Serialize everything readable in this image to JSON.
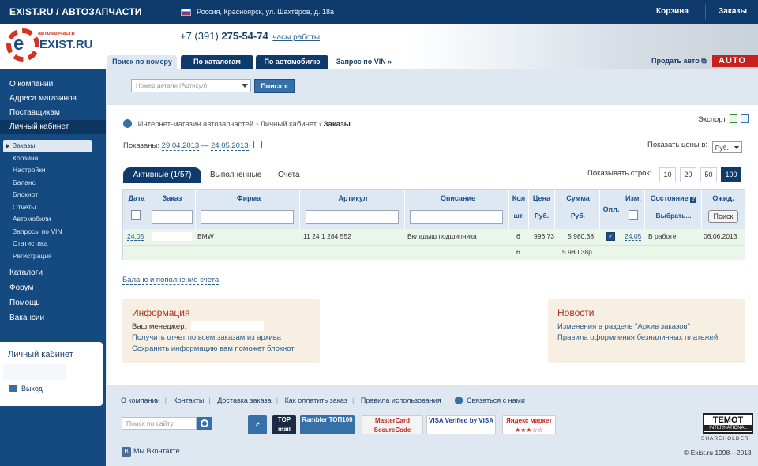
{
  "topbar": {
    "brand": "EXIST.RU / АВТОЗАПЧАСТИ",
    "location": "Россия, Красноярск, ул. Шахтёров, д. 18а",
    "cart": "Корзина",
    "orders": "Заказы"
  },
  "header": {
    "logo_sub": "автозапчасти",
    "logo_name": "EXIST.RU",
    "phone_prefix": "+7 (391)",
    "phone_number": "275-54-74",
    "hours": "часы работы",
    "tabs": [
      "Поиск по номеру",
      "По каталогам",
      "По автомобилю",
      "Запрос по VIN »"
    ],
    "sell": "Продать авто",
    "auto_ad": "AUTO"
  },
  "search": {
    "placeholder": "Номер детали (Артикул)",
    "button": "Поиск »"
  },
  "sidebar": {
    "main": [
      "О компании",
      "Адреса магазинов",
      "Поставщикам",
      "Личный кабинет"
    ],
    "sub": [
      "Заказы",
      "Корзина",
      "Настройки",
      "Баланс",
      "Блокнот",
      "Отчеты",
      "Автомобили",
      "Запросы по VIN",
      "Статистика",
      "Регистрация"
    ],
    "main2": [
      "Каталоги",
      "Форум",
      "Помощь",
      "Вакансии"
    ],
    "cabinet_title": "Личный кабинет",
    "exit": "Выход"
  },
  "breadcrumb": {
    "a": "Интернет-магазин автозапчастей",
    "b": "Личный кабинет",
    "current": "Заказы",
    "sep": "›"
  },
  "export": "Экспорт",
  "shown": {
    "label": "Показаны:",
    "from": "29.04.2013",
    "dash": "—",
    "to": "24.05.2013"
  },
  "prices": {
    "label": "Показать цены в:",
    "value": "Руб."
  },
  "subtabs": [
    "Активные (1/57)",
    "Выполненные",
    "Счета"
  ],
  "rows_label": "Показывать строк:",
  "rows_options": [
    "10",
    "20",
    "50",
    "100"
  ],
  "table": {
    "headers": [
      "Дата",
      "Заказ",
      "Фирма",
      "Артикул",
      "Описание",
      "Кол",
      "Цена",
      "Сумма",
      "Опл.",
      "Изм.",
      "Состояние",
      "Ожид."
    ],
    "subheaders": {
      "qty": "шт.",
      "price": "Руб.",
      "sum": "Руб.",
      "state": "Выбрать..."
    },
    "find_button": "Поиск",
    "row": {
      "date": "24.05",
      "brand": "BMW",
      "article": "11 24 1 284 552",
      "description": "Вкладыш подшипника",
      "qty": "6",
      "price": "996,73",
      "sum": "5 980,38",
      "changed": "24.05",
      "state": "В работе",
      "expected": "06.06.2013"
    },
    "total_qty": "6",
    "total_sum": "5 980,38р."
  },
  "balance_link": "Баланс и пополнение счета",
  "info": {
    "title": "Информация",
    "manager_label": "Ваш менеджер:",
    "line2": "Получить отчет по всем заказам из архива",
    "line3": "Сохранить информацию вам поможет блокнот"
  },
  "news": {
    "title": "Новости",
    "items": [
      "Изменения в разделе \"Архив заказов\"",
      "Правила оформления безналичных платежей"
    ]
  },
  "footer": {
    "links": [
      "О компании",
      "Контакты",
      "Доставка заказа",
      "Как оплатить заказ",
      "Правила использования"
    ],
    "chat": "Связаться с нами",
    "search_placeholder": "Поиск по сайту",
    "badges": [
      "TOP mail",
      "Rambler ТОП100",
      "MasterCard SecureCode",
      "VISA Verified by VISA",
      "Яндекс маркет ★★★☆☆"
    ],
    "vk": "Мы Вконтакте",
    "temot": "TEMOT",
    "temot_sub": "INTERNATIONAL",
    "shareholder": "SHAREHOLDER",
    "copyright": "© Exist.ru 1998—2013"
  },
  "colors": {
    "navy": "#0e3b6b",
    "sidebar": "#144a80",
    "accent_red": "#c8201c",
    "row_green": "#eaf6ea",
    "link": "#2b5d8c"
  }
}
